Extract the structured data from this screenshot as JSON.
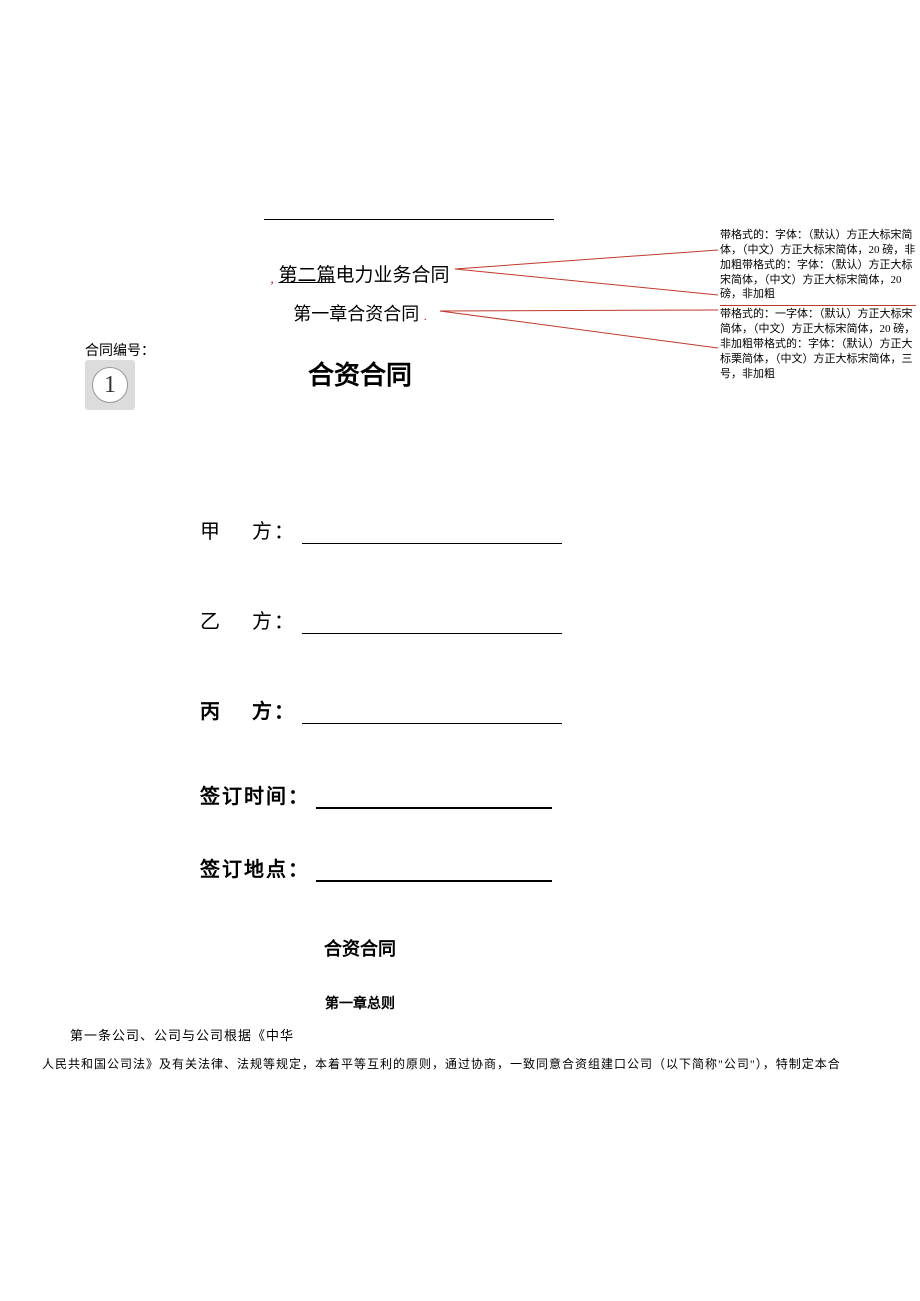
{
  "left": {
    "label": "合同编号：",
    "page_number": "1"
  },
  "titles": {
    "section1_comma": ",",
    "section1_underlined": "第二篇",
    "section1_rest": "电力业务合同",
    "section2": "第一章合资合同",
    "section2_dot": ".",
    "main": "合资合同"
  },
  "parties": {
    "a_label": "甲",
    "b_label": "乙",
    "c_label": "丙",
    "fang": "方：",
    "sign_time": "签订时间：",
    "sign_place": "签订地点："
  },
  "subtitle": "合资合同",
  "chapter": "第一章总则",
  "body": {
    "line1": "第一条公司、公司与公司根据《中华",
    "line2": "人民共和国公司法》及有关法律、法规等规定，本着平等互利的原则，通过协商，一致同意合资组建口公司（以下简称\"公司\"），特制定本合"
  },
  "comments": [
    "带格式的：字体：（默认）方正大标宋简体，（中文）方正大标宋简体，20 磅，非加粗带格式的：字体：（默认）方正大标宋简体，（中文）方正大标宋简体，20 磅，非加粗",
    "带格式的：一字体：（默认）方正大标宋简体，（中文）方正大标宋简体，20 磅，非加粗带格式的：字体：（默认）方正大标栗简体，（中文）方正大标宋简体，三号，非加粗"
  ]
}
